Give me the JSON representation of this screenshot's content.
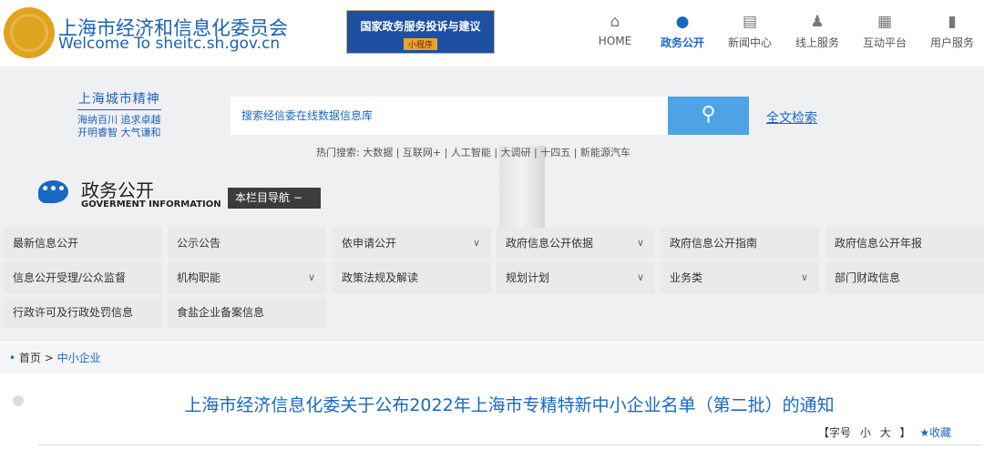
{
  "header": {
    "site_name": "上海市经济和信息化委员会",
    "site_url": "Welcome To sheitc.sh.gov.cn",
    "banner_title": "国家政务服务投诉与建议",
    "banner_sub": "小程序",
    "nav": [
      {
        "label": "HOME",
        "icon": "home-icon"
      },
      {
        "label": "政务公开",
        "icon": "chat-icon",
        "active": true
      },
      {
        "label": "新闻中心",
        "icon": "book-icon"
      },
      {
        "label": "线上服务",
        "icon": "users-icon"
      },
      {
        "label": "互动平台",
        "icon": "grid-icon"
      },
      {
        "label": "用户服务",
        "icon": "building-icon"
      }
    ]
  },
  "spirit": {
    "title": "上海城市精神",
    "line1": "海纳百川 追求卓越",
    "line2": "开明睿智 大气谦和"
  },
  "search": {
    "placeholder": "搜索经信委在线数据信息库",
    "fulltext_label": "全文检索",
    "hot_text": "热门搜索: 大数据 | 互联网+ | 人工智能 | 大调研 | 十四五 | 新能源汽车"
  },
  "section": {
    "title": "政务公开",
    "subtitle": "GOVERMENT INFORMATION",
    "column_nav": "本栏目导航 −"
  },
  "menu": [
    {
      "label": "最新信息公开",
      "chev": false
    },
    {
      "label": "公示公告",
      "chev": false
    },
    {
      "label": "依申请公开",
      "chev": true
    },
    {
      "label": "政府信息公开依据",
      "chev": true
    },
    {
      "label": "政府信息公开指南",
      "chev": false
    },
    {
      "label": "政府信息公开年报",
      "chev": false
    },
    {
      "label": "信息公开受理/公众监督",
      "chev": false
    },
    {
      "label": "机构职能",
      "chev": true
    },
    {
      "label": "政策法规及解读",
      "chev": false
    },
    {
      "label": "规划计划",
      "chev": true
    },
    {
      "label": "业务类",
      "chev": true
    },
    {
      "label": "部门财政信息",
      "chev": false
    },
    {
      "label": "行政许可及行政处罚信息",
      "chev": false
    },
    {
      "label": "食盐企业备案信息",
      "chev": false
    }
  ],
  "breadcrumb": {
    "home": "首页",
    "sep": ">",
    "current": "中小企业"
  },
  "article": {
    "title": "上海市经济信息化委关于公布2022年上海市专精特新中小企业名单（第二批）的通知",
    "font_label": "【字号",
    "small": "小",
    "large": "大",
    "close_bracket": "】",
    "favorite": "★收藏"
  },
  "colors": {
    "accent": "#1768c4",
    "search_button": "#4da3e3"
  }
}
